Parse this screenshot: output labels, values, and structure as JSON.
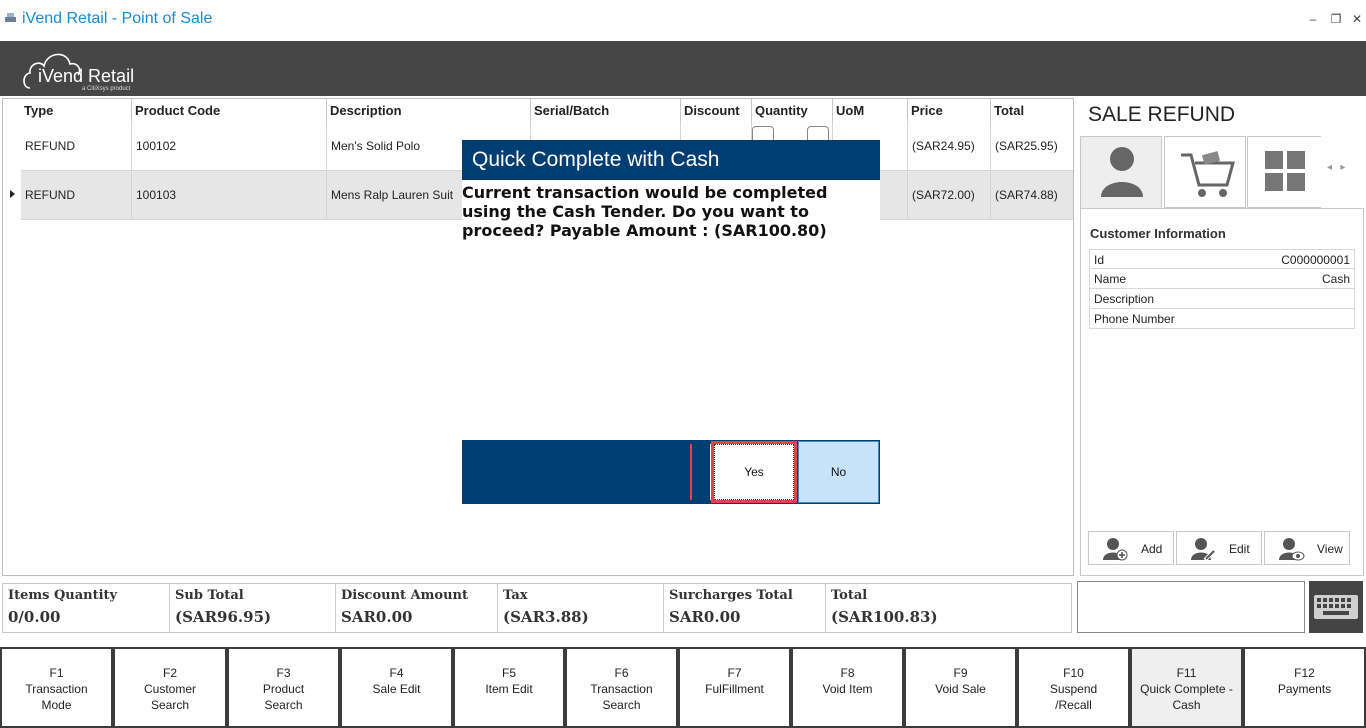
{
  "window": {
    "title": "iVend Retail - Point of Sale"
  },
  "brand": {
    "name": "iVend Retail",
    "sub": "a CitiXsys product"
  },
  "grid": {
    "columns": [
      "Type",
      "Product Code",
      "Description",
      "Serial/Batch",
      "Discount",
      "Quantity",
      "UoM",
      "Price",
      "Total"
    ],
    "rows": [
      {
        "type": "REFUND",
        "code": "100102",
        "description": "Men's Solid Polo",
        "serial": "",
        "discount": "",
        "quantity": "",
        "uom": "",
        "price": "(SAR24.95)",
        "total": "(SAR25.95)"
      },
      {
        "type": "REFUND",
        "code": "100103",
        "description": "Mens Ralp Lauren Suit",
        "serial": "",
        "discount": "",
        "quantity": "",
        "uom": "",
        "price": "(SAR72.00)",
        "total": "(SAR74.88)"
      }
    ]
  },
  "dialog": {
    "title": "Quick Complete with Cash",
    "message": "Current transaction would be completed using the Cash Tender. Do you want to proceed? Payable Amount : (SAR100.80)",
    "yes": "Yes",
    "no": "No"
  },
  "right_panel": {
    "mode": "SALE REFUND",
    "customer_title": "Customer Information",
    "fields": [
      {
        "k": "Id",
        "v": "C000000001"
      },
      {
        "k": "Name",
        "v": "Cash"
      },
      {
        "k": "Description",
        "v": ""
      },
      {
        "k": "Phone Number",
        "v": ""
      }
    ],
    "buttons": {
      "add": "Add",
      "edit": "Edit",
      "view": "View"
    }
  },
  "totals": [
    {
      "label": "Items Quantity",
      "value": "0/0.00"
    },
    {
      "label": "Sub Total",
      "value": "(SAR96.95)"
    },
    {
      "label": "Discount Amount",
      "value": "SAR0.00"
    },
    {
      "label": "Tax",
      "value": "(SAR3.88)"
    },
    {
      "label": "Surcharges Total",
      "value": "SAR0.00"
    },
    {
      "label": "Total",
      "value": "(SAR100.83)"
    }
  ],
  "fkeys": [
    "F1\nTransaction\nMode",
    "F2\nCustomer\nSearch",
    "F3\nProduct\nSearch",
    "F4\nSale Edit",
    "F5\nItem Edit",
    "F6\nTransaction\nSearch",
    "F7\nFulFillment",
    "F8\nVoid Item",
    "F9\nVoid Sale",
    "F10\nSuspend\n/Recall",
    "F11\nQuick Complete -\nCash",
    "F12\nPayments"
  ],
  "icons": [
    "app-icon",
    "minimize-icon",
    "restore-icon",
    "close-icon",
    "cloud-logo-icon",
    "customer-icon",
    "cart-icon",
    "grid-icon",
    "add-user-icon",
    "edit-user-icon",
    "view-user-icon",
    "keyboard-icon"
  ],
  "colors": {
    "accent": "#003d73",
    "title_blue": "#1b8ad1",
    "brand_bar": "#464646",
    "focus_red": "#e0454f",
    "no_button": "#c7e2fb"
  }
}
